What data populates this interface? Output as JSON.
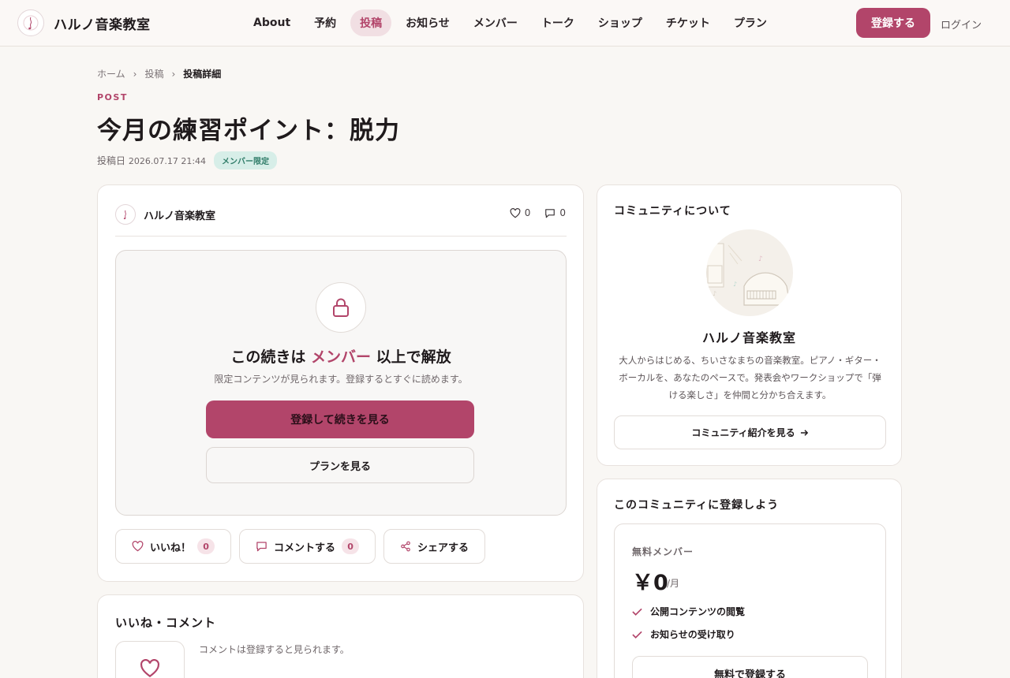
{
  "header": {
    "logo_text": "ハルノ音楽教室",
    "nav": [
      {
        "label": "About",
        "active": false
      },
      {
        "label": "予約",
        "active": false
      },
      {
        "label": "投稿",
        "active": true
      },
      {
        "label": "お知らせ",
        "active": false
      },
      {
        "label": "メンバー",
        "active": false
      },
      {
        "label": "トーク",
        "active": false
      },
      {
        "label": "ショップ",
        "active": false
      },
      {
        "label": "チケット",
        "active": false
      },
      {
        "label": "プラン",
        "active": false
      }
    ],
    "register_label": "登録する",
    "login_label": "ログイン"
  },
  "breadcrumb": {
    "home": "ホーム",
    "posts": "投稿",
    "current": "投稿詳細",
    "separator": "›"
  },
  "post": {
    "label": "POST",
    "title": "今月の練習ポイント：脱力",
    "date_label": "投稿日",
    "date": "2026.07.17 21:44",
    "badge": "メンバー限定",
    "author": "ハルノ音楽教室",
    "like_count": "0",
    "comment_count": "0"
  },
  "lock": {
    "title_before": "この続きは ",
    "title_highlight": "メンバー",
    "title_after": " 以上で解放",
    "subtitle": "限定コンテンツが見られます。登録するとすぐに読めます。",
    "primary_button": "登録して続きを見る",
    "secondary_button": "プランを見る"
  },
  "actions": {
    "like_label": "いいね！",
    "like_count": "0",
    "comment_label": "コメントする",
    "comment_count": "0",
    "share_label": "シェアする"
  },
  "comments": {
    "title": "いいね・コメント",
    "note": "コメントは登録すると見られます。"
  },
  "about": {
    "title": "コミュニティについて",
    "name": "ハルノ音楽教室",
    "description": "大人からはじめる、ちいさなまちの音楽教室。ピアノ・ギター・ボーカルを、あなたのペースで。発表会やワークショップで「弾ける楽しさ」を仲間と分かち合えます。",
    "button": "コミュニティ紹介を見る"
  },
  "join": {
    "title": "このコミュニティに登録しよう",
    "plan_name": "無料メンバー",
    "price": "￥0",
    "unit": "/月",
    "features": [
      "公開コンテンツの閲覧",
      "お知らせの受け取り"
    ],
    "button": "無料で登録する"
  },
  "colors": {
    "accent": "#b2456a",
    "accent_soft": "#f1dfe3",
    "badge_bg": "#d7eee8",
    "badge_text": "#2f7c68",
    "background": "#f9f7f4"
  }
}
